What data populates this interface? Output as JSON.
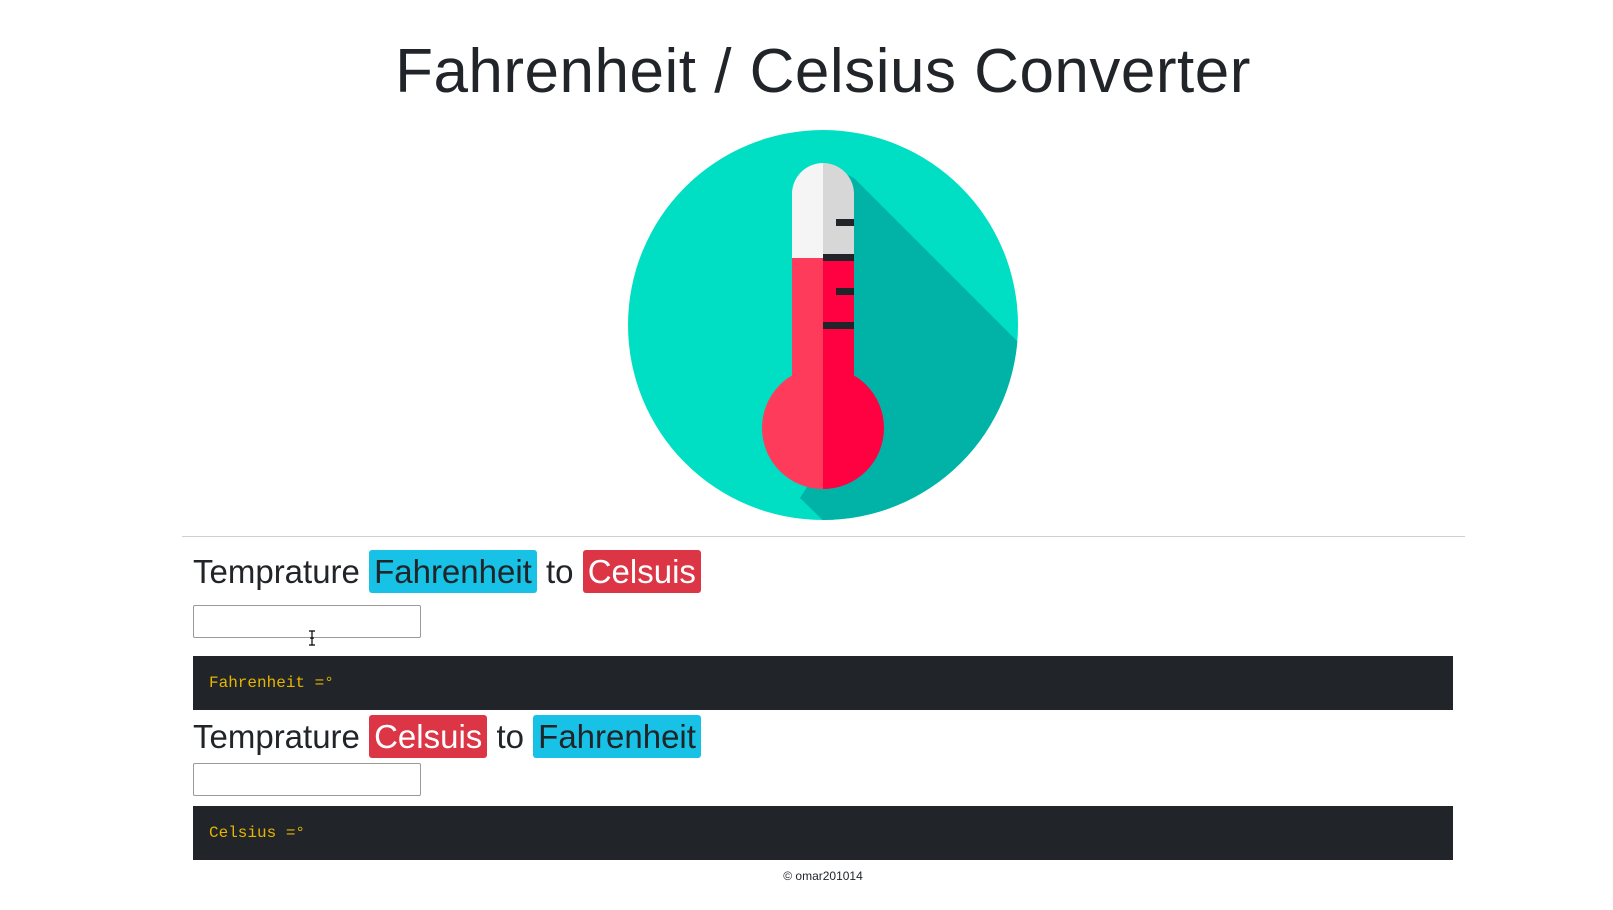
{
  "header": {
    "title": "Fahrenheit / Celsius Converter"
  },
  "logo": {
    "icon": "thermometer-icon",
    "colors": {
      "circle": "#00dfc3",
      "shadow": "#00b3a6",
      "mercury_light": "#ff3b5c",
      "mercury_dark": "#ff0040",
      "glass_light": "#f5f5f5",
      "glass_dark": "#d7d7d7",
      "ticks": "#212529"
    }
  },
  "f_to_c": {
    "word": "Temprature",
    "from": "Fahrenheit",
    "joiner": "to",
    "to": "Celsuis",
    "input_value": "",
    "result": "Fahrenheit =°"
  },
  "c_to_f": {
    "word": "Temprature",
    "from": "Celsuis",
    "joiner": "to",
    "to": "Fahrenheit",
    "input_value": "",
    "result": "Celsius =°"
  },
  "footer": {
    "text": "© omar201014"
  },
  "colors": {
    "info_badge": "#17c2e6",
    "danger_badge": "#dc3545",
    "result_bg": "#212529",
    "result_text": "#e8b400"
  }
}
